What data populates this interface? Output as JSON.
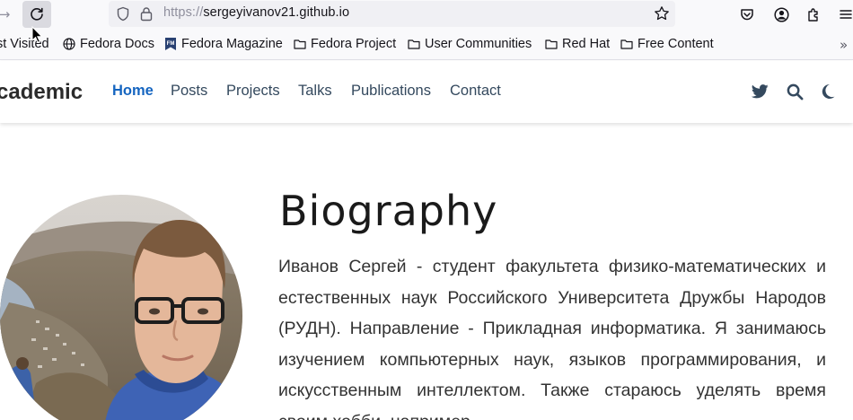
{
  "browser": {
    "url_proto": "https://",
    "url_host": "sergeyivanov21.github.io"
  },
  "bookmarks": {
    "items": [
      {
        "label": "st Visited",
        "icon": "gear-icon"
      },
      {
        "label": "Fedora Docs",
        "icon": "globe-icon"
      },
      {
        "label": "Fedora Magazine",
        "icon": "fm-favicon-icon"
      },
      {
        "label": "Fedora Project",
        "icon": "folder-icon"
      },
      {
        "label": "User Communities",
        "icon": "folder-icon"
      },
      {
        "label": "Red Hat",
        "icon": "folder-icon"
      },
      {
        "label": "Free Content",
        "icon": "folder-icon"
      }
    ],
    "overflow_label": "»"
  },
  "site": {
    "brand": "cademic",
    "nav": [
      {
        "label": "Home",
        "active": true
      },
      {
        "label": "Posts",
        "active": false
      },
      {
        "label": "Projects",
        "active": false
      },
      {
        "label": "Talks",
        "active": false
      },
      {
        "label": "Publications",
        "active": false
      },
      {
        "label": "Contact",
        "active": false
      }
    ],
    "accent_color": "#1565c0"
  },
  "biography": {
    "title": "Biography",
    "text": "Иванов Сергей - студент факультета физико-математических и естественных наук Российского Университета Дружбы Народов (РУДН). Направление - Прикладная информатика. Я занимаюсь изучением компьютерных наук, языков программирования, и искусственным интеллектом. Также стараюсь уделять время своим хобби, например,"
  }
}
